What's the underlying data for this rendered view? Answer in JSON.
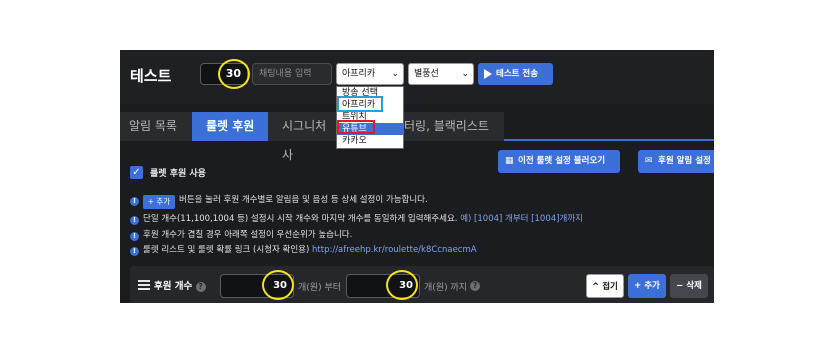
{
  "header": {
    "title": "테스트",
    "qty_value": "30",
    "chat_placeholder": "채팅내용 입력",
    "platform_select": "아프리카",
    "voice_select": "별풍선",
    "send_label": "테스트 전송"
  },
  "platform_options": [
    "방송 선택",
    "아프리카",
    "트위치",
    "유튜브",
    "카카오"
  ],
  "tabs": [
    {
      "label": "알림 목록"
    },
    {
      "label": "룰렛 후원"
    },
    {
      "label": "시그니처 사"
    },
    {
      "label": "터링, 블랙리스트"
    }
  ],
  "roulette": {
    "checkbox_label": "룰렛 후원 사용",
    "load_button": "이전 룰렛 설정 불러오기",
    "alert_button": "후원 알림 설정"
  },
  "info": {
    "add_label": "+ 추가",
    "line1": "버튼을 눌러 후원 개수별로 알림음 및 음성 등 상세 설정이 가능합니다.",
    "line2": "단일 개수(11,100,1004 등) 설정시 시작 개수와 마지막 개수를 동일하게 입력해주세요.",
    "line2_example": "예) [1004] 개부터 [1004]개까지",
    "line3": "후원 개수가 겹칠 경우 아래쪽 설정이 우선순위가 높습니다.",
    "line4": "룰렛 리스트 및 룰렛 확률 링크 (시청자 확인용)",
    "line4_link": "http://afreehp.kr/roulette/k8CcnaecmA"
  },
  "count_row": {
    "label": "후원 개수",
    "from_value": "30",
    "from_unit": "개(원) 부터",
    "to_value": "30",
    "to_unit": "개(원) 까지",
    "fold_label": "접기",
    "add_label": "추가",
    "delete_label": "삭제"
  },
  "colors": {
    "accent": "#3d6fd9",
    "highlight_circle": "#f4e31a",
    "box_blue": "#22a2d8",
    "box_red": "#e01a2b"
  }
}
